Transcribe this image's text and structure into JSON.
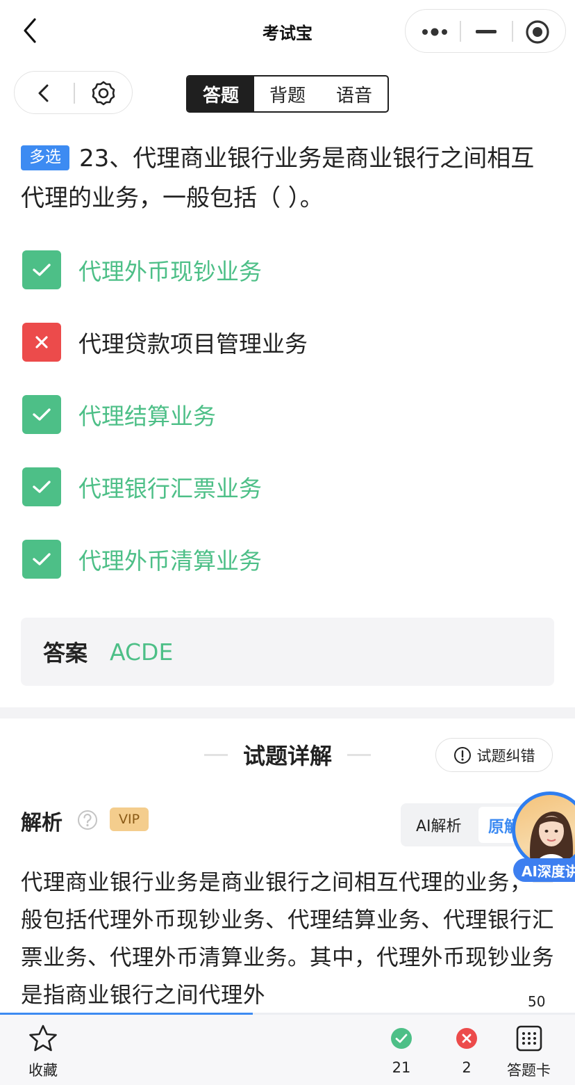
{
  "app": {
    "title": "考试宝"
  },
  "modes": [
    {
      "label": "答题",
      "active": true
    },
    {
      "label": "背题",
      "active": false
    },
    {
      "label": "语音",
      "active": false
    }
  ],
  "question": {
    "type_badge": "多选",
    "text": "23、代理商业银行业务是商业银行之间相互代理的业务，一般包括（ ）。"
  },
  "options": [
    {
      "text": "代理外币现钞业务",
      "status": "correct"
    },
    {
      "text": "代理贷款项目管理业务",
      "status": "wrong"
    },
    {
      "text": "代理结算业务",
      "status": "correct"
    },
    {
      "text": "代理银行汇票业务",
      "status": "correct"
    },
    {
      "text": "代理外币清算业务",
      "status": "correct"
    }
  ],
  "answer": {
    "label": "答案",
    "value": "ACDE"
  },
  "detail": {
    "heading": "试题详解",
    "report_label": "试题纠错",
    "analysis_label": "解析",
    "vip_label": "VIP",
    "seg_ai": "AI解析",
    "seg_orig": "原解",
    "ai_tag": "AI深度讲",
    "analysis_text": "代理商业银行业务是商业银行之间相互代理的业务，一般包括代理外币现钞业务、代理结算业务、代理银行汇票业务、代理外币清算业务。其中，代理外币现钞业务是指商业银行之间代理外"
  },
  "progress": {
    "total": "50",
    "fraction": 0.44
  },
  "bottombar": {
    "favorite_label": "收藏",
    "correct_count": "21",
    "wrong_count": "2",
    "card_label": "答题卡"
  },
  "colors": {
    "correct": "#4dbf87",
    "wrong": "#ec4b4b",
    "accent": "#3d8bf2"
  }
}
